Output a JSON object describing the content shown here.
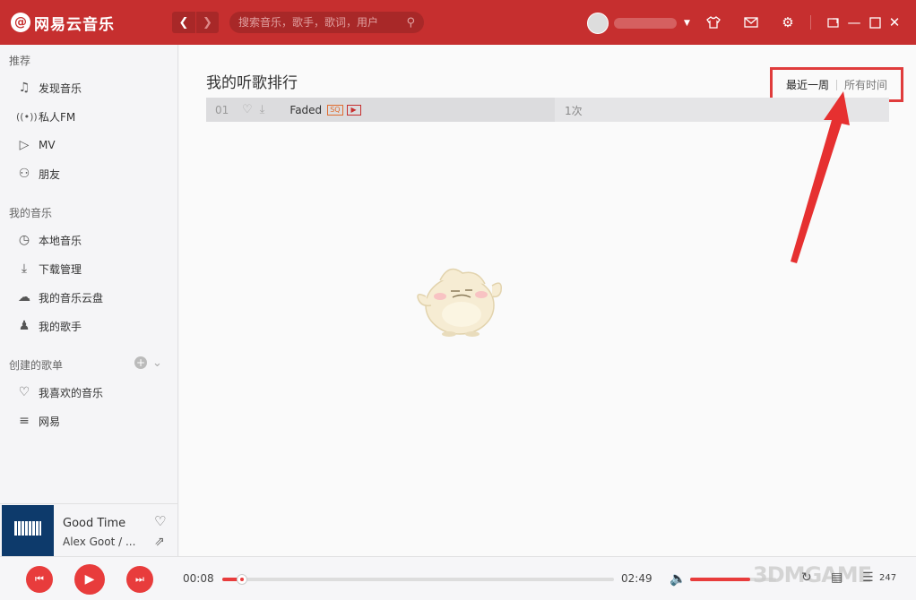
{
  "app": {
    "title": "网易云音乐",
    "logo_glyph": "@",
    "accent": "#c62f2f"
  },
  "titlebar": {
    "search_placeholder": "搜索音乐，歌手，歌词，用户",
    "back_icon": "chevron-left-icon",
    "forward_icon": "chevron-right-icon",
    "icons": [
      "skin-icon",
      "mail-icon",
      "settings-icon",
      "mini-mode-icon",
      "minimize-icon",
      "maximize-icon",
      "close-icon"
    ]
  },
  "sidebar": {
    "sections": [
      {
        "title": "推荐",
        "items": [
          {
            "label": "发现音乐",
            "icon": "music-note-icon"
          },
          {
            "label": "私人FM",
            "icon": "radio-icon"
          },
          {
            "label": "MV",
            "icon": "video-icon"
          },
          {
            "label": "朋友",
            "icon": "friends-icon"
          }
        ]
      },
      {
        "title": "我的音乐",
        "items": [
          {
            "label": "本地音乐",
            "icon": "disc-icon"
          },
          {
            "label": "下载管理",
            "icon": "download-icon"
          },
          {
            "label": "我的音乐云盘",
            "icon": "cloud-icon"
          },
          {
            "label": "我的歌手",
            "icon": "singer-icon"
          }
        ]
      },
      {
        "title": "创建的歌单",
        "items": [
          {
            "label": "我喜欢的音乐",
            "icon": "heart-icon"
          },
          {
            "label": "网易",
            "icon": "playlist-icon"
          }
        ]
      }
    ]
  },
  "now_playing": {
    "title": "Good Time",
    "artist": "Alex Goot / ..."
  },
  "main": {
    "title": "我的听歌排行",
    "tabs": {
      "week": "最近一周",
      "all": "所有时间"
    },
    "rows": [
      {
        "rank": "01",
        "title": "Faded",
        "quality_tag": "SQ",
        "count": "1次",
        "bar_fraction": 0.51
      }
    ]
  },
  "player": {
    "current_time": "00:08",
    "total_time": "02:49",
    "progress_fraction": 0.05,
    "volume_fraction": 0.7,
    "playlist_count": "247",
    "watermark": "3DMGAME"
  }
}
